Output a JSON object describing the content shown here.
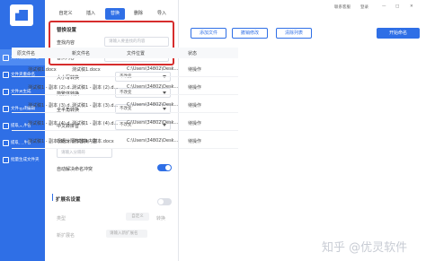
{
  "sidebar": {
    "items": [
      {
        "label": "文件批量重命名",
        "active": true
      },
      {
        "label": "文件夹重命名",
        "active": false
      },
      {
        "label": "文件夹生成",
        "active": false
      },
      {
        "label": "文件名转编辑",
        "active": false
      },
      {
        "label": "提取文件名",
        "active": false
      },
      {
        "label": "提取文件名",
        "active": false
      },
      {
        "label": "批量生成文件夹",
        "active": false
      }
    ]
  },
  "tabs": [
    "自定义",
    "插入",
    "替换",
    "删除",
    "导入"
  ],
  "active_tab": "替换",
  "replace": {
    "heading": "替换设置",
    "find_label": "查找内容",
    "find_placeholder": "请输入要查找的内容",
    "replace_label": "替换内容",
    "replace_placeholder": "请输入要替换的内容"
  },
  "options": [
    {
      "label": "大小写转换",
      "value": "不改变"
    },
    {
      "label": "简繁体转换",
      "value": "不改变"
    },
    {
      "label": "全半角转换",
      "value": "不改变"
    },
    {
      "label": "中文转拼音",
      "value": "不改变"
    }
  ],
  "position": {
    "label": "根据分隔符替换内容",
    "placeholder": "请输入分隔符"
  },
  "auto_conflict": {
    "label": "自动解决命名冲突",
    "enabled": true
  },
  "ext": {
    "heading": "扩展名设置",
    "enabled": false,
    "type_label": "类型",
    "type_options": [
      "自定义",
      "转换"
    ],
    "new_ext_label": "新扩展名",
    "new_ext_placeholder": "请输入新扩展名"
  },
  "top_right": {
    "support": "联系客服",
    "login": "登录"
  },
  "toolbar": {
    "add_files": "添加文件",
    "undo": "撤销修改",
    "clear": "清除列表",
    "start": "开始命名"
  },
  "table": {
    "headers": [
      "原文件名",
      "新文件名",
      "文件位置",
      "状态"
    ],
    "rows": [
      {
        "orig": "测试稿1.docx",
        "new": "测试稿1.docx",
        "path": "C:\\Users\\34802\\Desk...",
        "status": "待操作"
      },
      {
        "orig": "测试稿1 - 副本 (2).d...",
        "new": "测试稿1 - 副本 (2).d...",
        "path": "C:\\Users\\34802\\Desk...",
        "status": "待操作"
      },
      {
        "orig": "测试稿1 - 副本 (3).d...",
        "new": "测试稿1 - 副本 (3).d...",
        "path": "C:\\Users\\34802\\Desk...",
        "status": "待操作"
      },
      {
        "orig": "测试稿1 - 副本 (4).d...",
        "new": "测试稿1 - 副本 (4).d...",
        "path": "C:\\Users\\34802\\Desk...",
        "status": "待操作"
      },
      {
        "orig": "测试稿1 - 副本.docx",
        "new": "测试稿1 - 副本.docx",
        "path": "C:\\Users\\34802\\Desk...",
        "status": "待操作"
      }
    ]
  },
  "watermark": "知乎 @优灵软件",
  "colors": {
    "accent": "#2f6fe6",
    "highlight": "#d62d2d",
    "toggle_off": "#dcdfe6"
  }
}
